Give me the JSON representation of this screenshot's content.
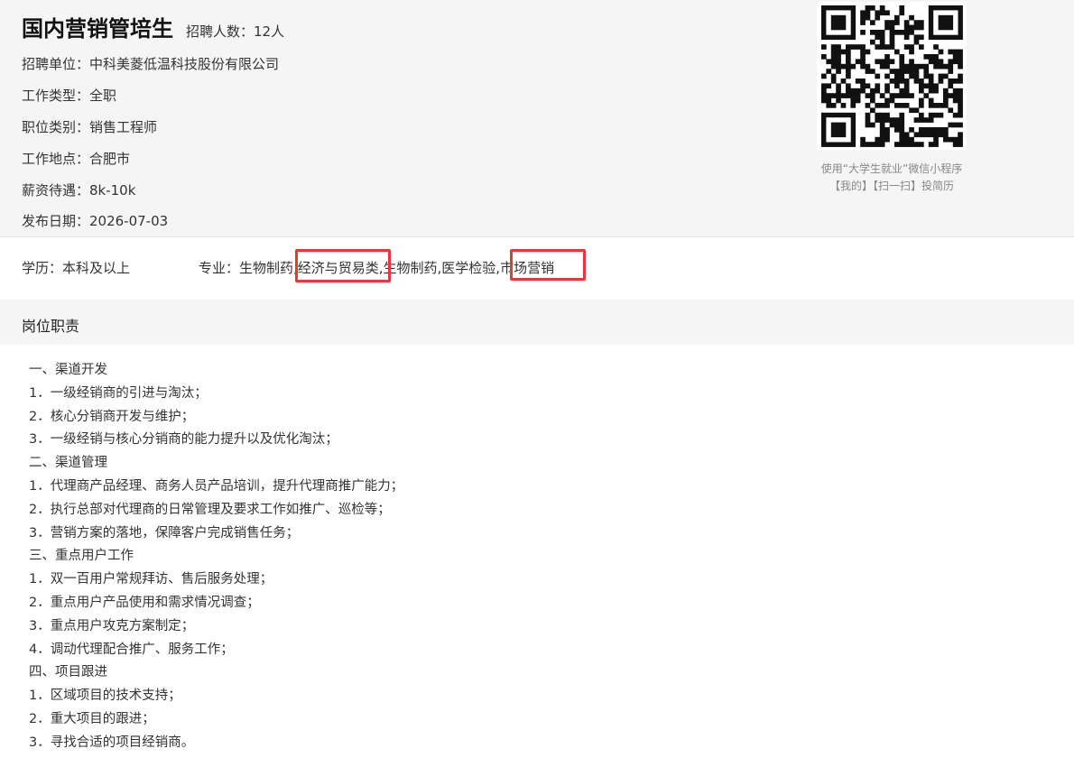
{
  "job": {
    "title": "国内营销管培生",
    "headcount": "招聘人数：12人"
  },
  "info": [
    "招聘单位：中科美菱低温科技股份有限公司",
    "工作类型：全职",
    "职位类别：销售工程师",
    "工作地点：合肥市",
    "薪资待遇：8k-10k",
    "发布日期：2026-07-03"
  ],
  "qr": {
    "icon": "qr-code-icon",
    "caption_line1": "使用“大学生就业”微信小程序",
    "caption_line2": "【我的】【扫一扫】投简历"
  },
  "requirements": {
    "education": "学历：本科及以上",
    "major": "专业：生物制药,经济与贸易类,生物制药,医学检验,市场营销",
    "highlight_color": "#e53935"
  },
  "duties": {
    "section_title": "岗位职责",
    "lines": [
      "一、渠道开发",
      "1．一级经销商的引进与淘汰；",
      "2．核心分销商开发与维护；",
      "3．一级经销与核心分销商的能力提升以及优化淘汰；",
      "二、渠道管理",
      "1．代理商产品经理、商务人员产品培训，提升代理商推广能力；",
      "2．执行总部对代理商的日常管理及要求工作如推广、巡检等；",
      "3．营销方案的落地，保障客户完成销售任务；",
      "三、重点用户工作",
      "1．双一百用户常规拜访、售后服务处理；",
      "2．重点用户产品使用和需求情况调查；",
      "3．重点用户攻克方案制定；",
      "4．调动代理配合推广、服务工作；",
      "四、项目跟进",
      "1．区域项目的技术支持；",
      "2．重大项目的跟进；",
      "3．寻找合适的项目经销商。"
    ]
  }
}
